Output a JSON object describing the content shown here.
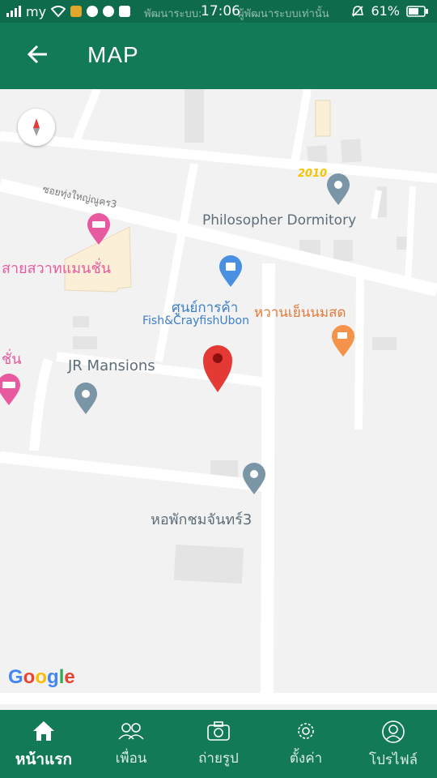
{
  "status_bar": {
    "carrier": "my",
    "ticker_left": "พัฒนาระบบ:",
    "time": "17:06",
    "ticker_right": "ผู้พัฒนาระบบเท่านั้น",
    "battery": "61%"
  },
  "app_bar": {
    "title": "MAP",
    "back_icon": "arrow-left-icon"
  },
  "map": {
    "street_labels": {
      "soi": "ซอยทุ่งใหญ่ณูคร3",
      "road_number": "2010"
    },
    "pois": {
      "philosopher": "Philosopher Dormitory",
      "saisawat": "สายสวาทแมนชั่น",
      "shop_th": "ศูนย์การค้า",
      "shop_en": "Fish&CrayfishUbon",
      "sweet": "หวานเย็นนมสด",
      "chan_partial": "ชั่น",
      "jr": "JR Mansions",
      "chomchan": "หอพักชมจันทร์3"
    },
    "google_logo": [
      "G",
      "o",
      "o",
      "g",
      "l",
      "e"
    ],
    "colors": {
      "hotel_pin": "#e85aa0",
      "shop_pin": "#4a90e2",
      "cafe_pin": "#f5934a",
      "generic_pin": "#7a95a6",
      "selected_pin": "#e53935"
    }
  },
  "bottom_nav": {
    "items": [
      {
        "label": "หน้าแรก",
        "icon": "home-icon",
        "active": true
      },
      {
        "label": "เพื่อน",
        "icon": "friends-icon",
        "active": false
      },
      {
        "label": "ถ่ายรูป",
        "icon": "camera-icon",
        "active": false
      },
      {
        "label": "ตั้งค่า",
        "icon": "gear-icon",
        "active": false
      },
      {
        "label": "โปรไฟล์",
        "icon": "profile-icon",
        "active": false
      }
    ]
  }
}
